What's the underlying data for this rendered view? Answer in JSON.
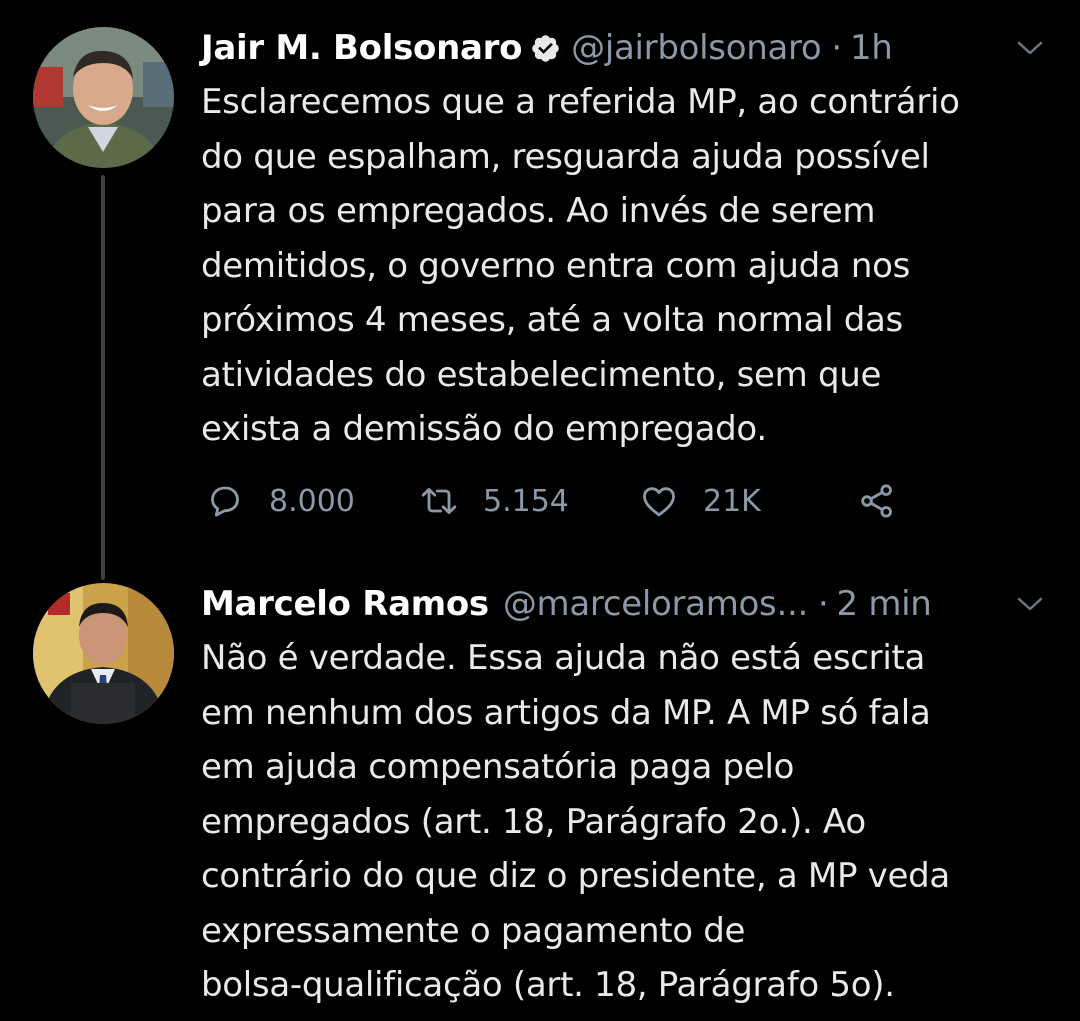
{
  "tweets": [
    {
      "display_name": "Jair M. Bolsonaro",
      "handle": "@jairbolsonaro",
      "separator": "·",
      "time": "1h",
      "verified": true,
      "body_lines": [
        "Esclarecemos que a referida MP, ao contrário",
        "do que espalham, resguarda ajuda possível",
        "para os empregados. Ao invés de serem",
        "demitidos, o governo entra com ajuda nos",
        "próximos 4 meses, até a volta normal das",
        "atividades do estabelecimento, sem que",
        "exista a demissão do empregado."
      ],
      "stats": {
        "replies": "8.000",
        "retweets": "5.154",
        "likes": "21K"
      }
    },
    {
      "display_name": "Marcelo Ramos",
      "handle": "@marceloramos...",
      "separator": "·",
      "time": "2 min",
      "verified": false,
      "body_lines": [
        "Não é verdade. Essa ajuda não está escrita",
        "em nenhum dos artigos da MP. A MP só fala",
        "em ajuda compensatória paga pelo",
        "empregados (art. 18, Parágrafo 2o.). Ao",
        "contrário do que diz o presidente, a MP veda",
        "expressamente o pagamento de",
        "bolsa-qualificação (art. 18, Parágrafo 5o)."
      ]
    }
  ],
  "colors": {
    "background": "#000000",
    "text": "#e7e9ea",
    "secondary": "#8b98a5",
    "thread_line": "#3a3f44"
  },
  "icons": {
    "verified": "verified-badge-icon",
    "menu": "chevron-down-icon",
    "reply": "reply-icon",
    "retweet": "retweet-icon",
    "like": "heart-icon",
    "share": "share-icon"
  }
}
